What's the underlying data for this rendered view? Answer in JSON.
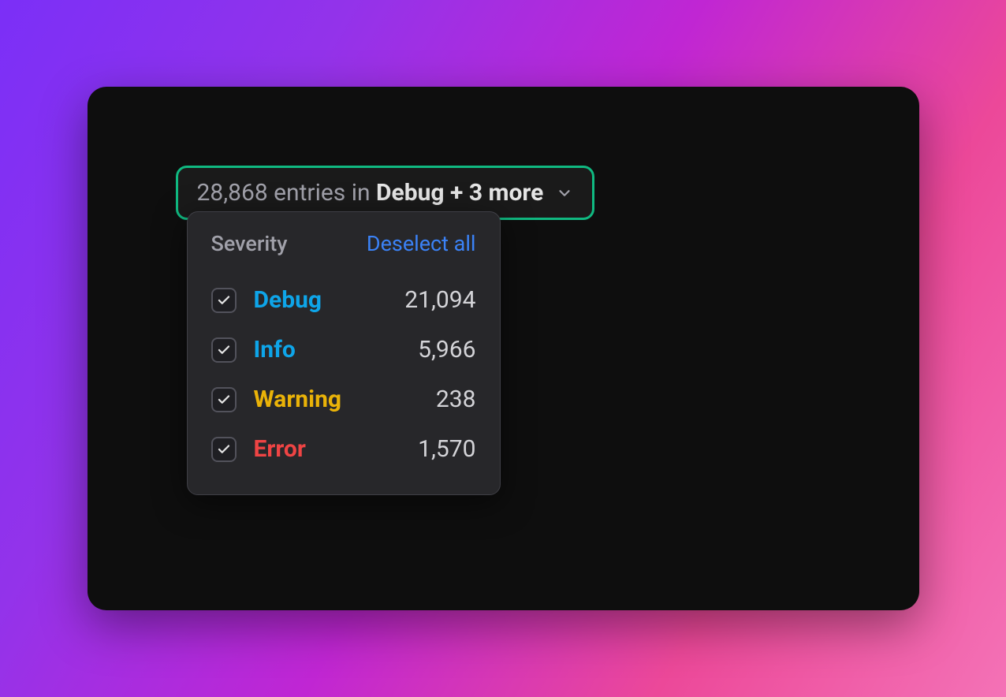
{
  "trigger": {
    "prefix": "28,868 entries in ",
    "bold": "Debug + 3 more"
  },
  "menu": {
    "title": "Severity",
    "deselect_label": "Deselect all",
    "options": [
      {
        "label": "Debug",
        "count": "21,094",
        "color_class": "color-debug",
        "checked": true
      },
      {
        "label": "Info",
        "count": "5,966",
        "color_class": "color-info",
        "checked": true
      },
      {
        "label": "Warning",
        "count": "238",
        "color_class": "color-warning",
        "checked": true
      },
      {
        "label": "Error",
        "count": "1,570",
        "color_class": "color-error",
        "checked": true
      }
    ]
  }
}
